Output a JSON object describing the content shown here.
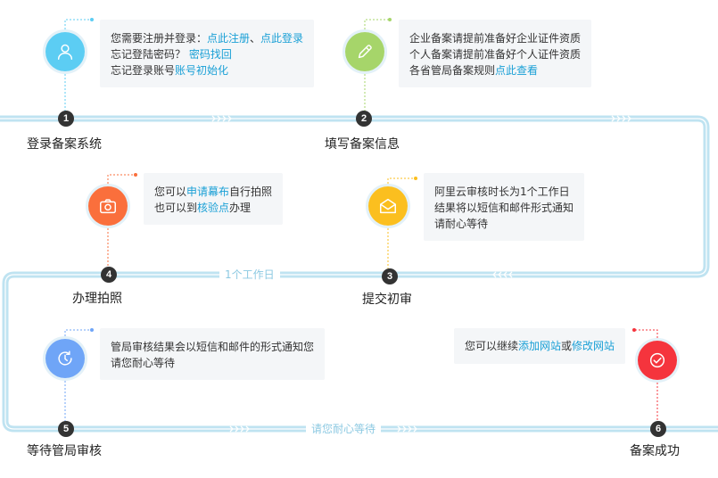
{
  "steps": [
    {
      "num": "1",
      "label": "登录备案系统",
      "color": "#5ccdf3",
      "icon": "user-icon",
      "bubble": [
        [
          {
            "t": "您需要注册并登录："
          },
          {
            "t": "点此注册",
            "link": true
          },
          {
            "t": "、"
          },
          {
            "t": "点此登录",
            "link": true
          }
        ],
        [
          {
            "t": "忘记登陆密码？ "
          },
          {
            "t": "密码找回",
            "link": true
          }
        ],
        [
          {
            "t": "忘记登录账号"
          },
          {
            "t": "账号初始化",
            "link": true
          }
        ]
      ]
    },
    {
      "num": "2",
      "label": "填写备案信息",
      "color": "#a6d56a",
      "icon": "pencil-icon",
      "bubble": [
        [
          {
            "t": "企业备案请提前准备好企业证件资质"
          }
        ],
        [
          {
            "t": "个人备案请提前准备好个人证件资质"
          }
        ],
        [
          {
            "t": "各省管局备案规则"
          },
          {
            "t": "点此查看",
            "link": true
          }
        ]
      ]
    },
    {
      "num": "3",
      "label": "提交初审",
      "color": "#fbbf1f",
      "icon": "envelope-icon",
      "bubble": [
        [
          {
            "t": "阿里云审核时长为1个工作日"
          }
        ],
        [
          {
            "t": "结果将以短信和邮件形式通知"
          }
        ],
        [
          {
            "t": "请耐心等待"
          }
        ]
      ]
    },
    {
      "num": "4",
      "label": "办理拍照",
      "color": "#fa6f3c",
      "icon": "camera-icon",
      "bubble": [
        [
          {
            "t": "您可以"
          },
          {
            "t": "申请幕布",
            "link": true
          },
          {
            "t": "自行拍照"
          }
        ],
        [
          {
            "t": "也可以到"
          },
          {
            "t": "核验点",
            "link": true
          },
          {
            "t": "办理"
          }
        ]
      ]
    },
    {
      "num": "5",
      "label": "等待管局审核",
      "color": "#6fa5f7",
      "icon": "clock-icon",
      "bubble": [
        [
          {
            "t": "管局审核结果会以短信和邮件的形式通知您"
          }
        ],
        [
          {
            "t": "请您耐心等待"
          }
        ]
      ]
    },
    {
      "num": "6",
      "label": "备案成功",
      "color": "#f5343d",
      "icon": "check-icon",
      "bubble": [
        [
          {
            "t": "您可以继续"
          },
          {
            "t": "添加网站",
            "link": true
          },
          {
            "t": "或"
          },
          {
            "t": "修改网站",
            "link": true
          }
        ]
      ]
    }
  ],
  "track_labels": {
    "middle": "1个工作日",
    "bottom": "请您耐心等待"
  },
  "colors": {
    "track": "#bfe3f1",
    "link": "#1aa0d6",
    "bubble_bg": "#f4f6f8",
    "badge": "#333333"
  }
}
